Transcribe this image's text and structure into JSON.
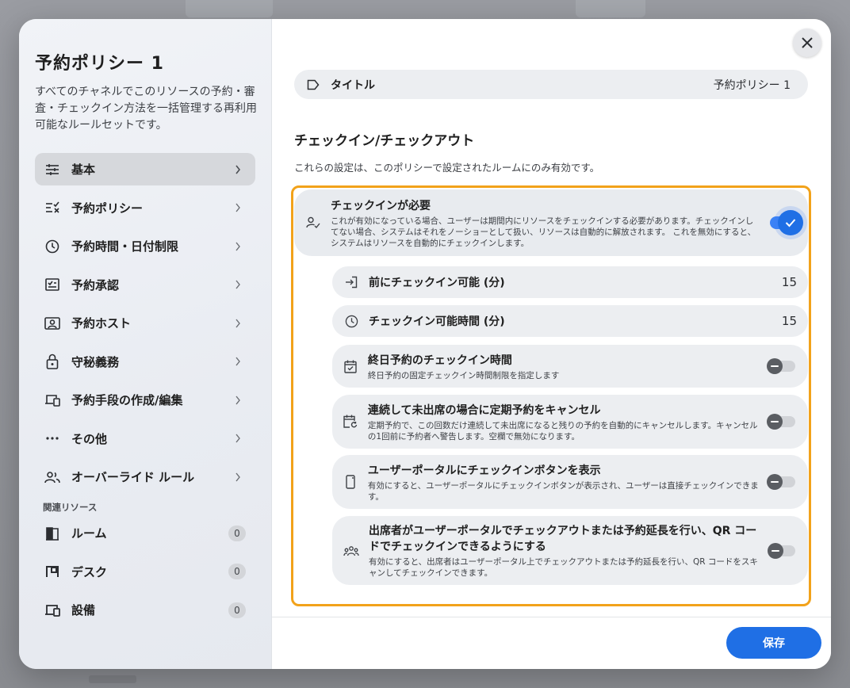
{
  "sidebar": {
    "title": "予約ポリシー 1",
    "description": "すべてのチャネルでこのリソースの予約・審査・チェックイン方法を一括管理する再利用可能なルールセットです。",
    "items": [
      {
        "label": "基本",
        "icon": "sliders-icon",
        "active": true
      },
      {
        "label": "予約ポリシー",
        "icon": "checklist-icon",
        "active": false
      },
      {
        "label": "予約時間・日付制限",
        "icon": "clock-icon",
        "active": false
      },
      {
        "label": "予約承認",
        "icon": "approval-icon",
        "active": false
      },
      {
        "label": "予約ホスト",
        "icon": "host-icon",
        "active": false
      },
      {
        "label": "守秘義務",
        "icon": "lock-icon",
        "active": false
      },
      {
        "label": "予約手段の作成/編集",
        "icon": "devices-icon",
        "active": false
      },
      {
        "label": "その他",
        "icon": "more-icon",
        "active": false
      },
      {
        "label": "オーバーライド ルール",
        "icon": "people-icon",
        "active": false
      }
    ],
    "related_label": "関連リソース",
    "related": [
      {
        "label": "ルーム",
        "icon": "room-icon",
        "count": "0"
      },
      {
        "label": "デスク",
        "icon": "desk-icon",
        "count": "0"
      },
      {
        "label": "設備",
        "icon": "equipment-icon",
        "count": "0"
      }
    ]
  },
  "main": {
    "title_field": {
      "label": "タイトル",
      "value": "予約ポリシー 1",
      "icon": "label-icon"
    },
    "section_heading": "チェックイン/チェックアウト",
    "section_subtitle": "これらの設定は、このポリシーで設定されたルームにのみ有効です。",
    "checkin_required": {
      "title": "チェックインが必要",
      "description": "これが有効になっている場合、ユーザーは期間内にリソースをチェックインする必要があります。チェックインしてない場合、システムはそれをノーショーとして扱い、リソースは自動的に解放されます。 これを無効にすると、システムはリソースを自動的にチェックインします。",
      "enabled": true,
      "icon": "person-check-icon"
    },
    "settings": [
      {
        "title": "前にチェックイン可能 (分)",
        "value": "15",
        "icon": "login-icon"
      },
      {
        "title": "チェックイン可能時間 (分)",
        "value": "15",
        "icon": "clock-icon"
      },
      {
        "title": "終日予約のチェックイン時間",
        "description": "終日予約の固定チェックイン時間制限を指定します",
        "enabled": false,
        "icon": "calendar-check-icon"
      },
      {
        "title": "連続して未出席の場合に定期予約をキャンセル",
        "description": "定期予約で、この回数だけ連続して未出席になると残りの予約を自動的にキャンセルします。キャンセルの1回前に予約者へ警告します。空欄で無効になります。",
        "enabled": false,
        "icon": "calendar-repeat-icon"
      },
      {
        "title": "ユーザーポータルにチェックインボタンを表示",
        "description": "有効にすると、ユーザーポータルにチェックインボタンが表示され、ユーザーは直接チェックインできます。",
        "enabled": false,
        "icon": "phone-icon"
      },
      {
        "title": "出席者がユーザーポータルでチェックアウトまたは予約延長を行い、QR コードでチェックインできるようにする",
        "description": "有効にすると、出席者はユーザーポータル上でチェックアウトまたは予約延長を行い、QR コードをスキャンしてチェックインできます。",
        "enabled": false,
        "icon": "group-icon"
      }
    ],
    "save_label": "保存"
  },
  "colors": {
    "accent": "#1f6fe5",
    "highlight": "#f2a21a"
  }
}
